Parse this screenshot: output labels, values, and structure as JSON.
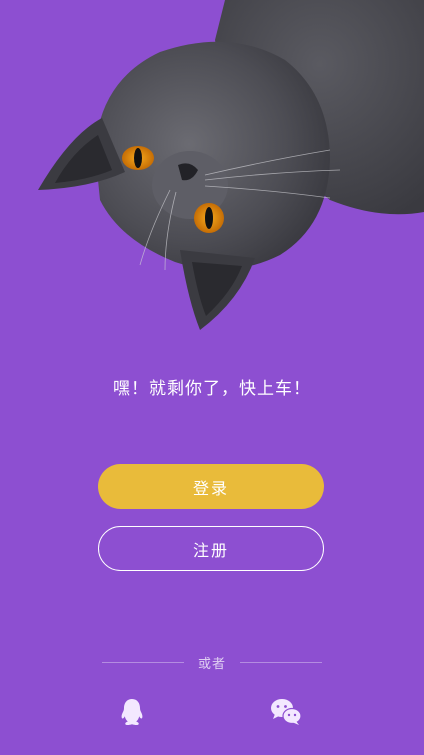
{
  "tagline": "嘿！就剩你了，快上车！",
  "buttons": {
    "login": "登录",
    "register": "注册"
  },
  "divider_text": "或者",
  "social": [
    {
      "icon": "qq-icon"
    },
    {
      "icon": "wechat-icon"
    }
  ],
  "colors": {
    "background": "#8d4fd1",
    "login_button": "#e9bb3a",
    "text": "#ffffff"
  }
}
